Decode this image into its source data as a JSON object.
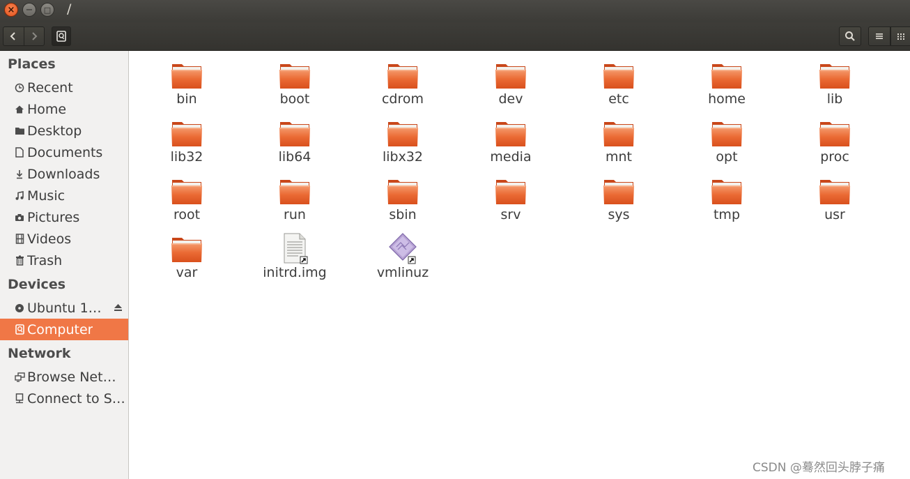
{
  "window": {
    "title": "/",
    "close_glyph": "×",
    "minimize_glyph": "−",
    "maximize_glyph": "□"
  },
  "toolbar": {
    "back_icon": "chevron-left-icon",
    "forward_icon": "chevron-right-icon",
    "path_icon": "computer-drive-icon",
    "search_icon": "search-icon",
    "list_view_icon": "list-view-icon",
    "grid_view_icon": "grid-view-icon"
  },
  "sidebar": {
    "sections": [
      {
        "title": "Places"
      },
      {
        "title": "Devices"
      },
      {
        "title": "Network"
      }
    ],
    "places": [
      {
        "label": "Recent",
        "icon": "clock-icon"
      },
      {
        "label": "Home",
        "icon": "home-icon"
      },
      {
        "label": "Desktop",
        "icon": "folder-icon"
      },
      {
        "label": "Documents",
        "icon": "document-icon"
      },
      {
        "label": "Downloads",
        "icon": "download-icon"
      },
      {
        "label": "Music",
        "icon": "music-icon"
      },
      {
        "label": "Pictures",
        "icon": "camera-icon"
      },
      {
        "label": "Videos",
        "icon": "film-icon"
      },
      {
        "label": "Trash",
        "icon": "trash-icon"
      }
    ],
    "devices": [
      {
        "label": "Ubuntu 1…",
        "icon": "disc-icon",
        "eject_icon": "eject-icon"
      },
      {
        "label": "Computer",
        "icon": "computer-drive-icon",
        "active": true
      }
    ],
    "network": [
      {
        "label": "Browse Net…",
        "icon": "network-icon"
      },
      {
        "label": "Connect to S…",
        "icon": "server-icon"
      }
    ]
  },
  "files": [
    {
      "name": "bin",
      "type": "folder"
    },
    {
      "name": "boot",
      "type": "folder"
    },
    {
      "name": "cdrom",
      "type": "folder"
    },
    {
      "name": "dev",
      "type": "folder"
    },
    {
      "name": "etc",
      "type": "folder"
    },
    {
      "name": "home",
      "type": "folder"
    },
    {
      "name": "lib",
      "type": "folder"
    },
    {
      "name": "lib32",
      "type": "folder"
    },
    {
      "name": "lib64",
      "type": "folder"
    },
    {
      "name": "libx32",
      "type": "folder"
    },
    {
      "name": "media",
      "type": "folder"
    },
    {
      "name": "mnt",
      "type": "folder"
    },
    {
      "name": "opt",
      "type": "folder"
    },
    {
      "name": "proc",
      "type": "folder"
    },
    {
      "name": "root",
      "type": "folder"
    },
    {
      "name": "run",
      "type": "folder"
    },
    {
      "name": "sbin",
      "type": "folder"
    },
    {
      "name": "srv",
      "type": "folder"
    },
    {
      "name": "sys",
      "type": "folder"
    },
    {
      "name": "tmp",
      "type": "folder"
    },
    {
      "name": "usr",
      "type": "folder"
    },
    {
      "name": "var",
      "type": "folder"
    },
    {
      "name": "initrd.img",
      "type": "document-link"
    },
    {
      "name": "vmlinuz",
      "type": "binary-link"
    }
  ],
  "watermark": "CSDN @蓦然回头脖子痛",
  "colors": {
    "selection": "#f07746",
    "folder": "#e9632c",
    "titlebar": "#3c3b37"
  }
}
